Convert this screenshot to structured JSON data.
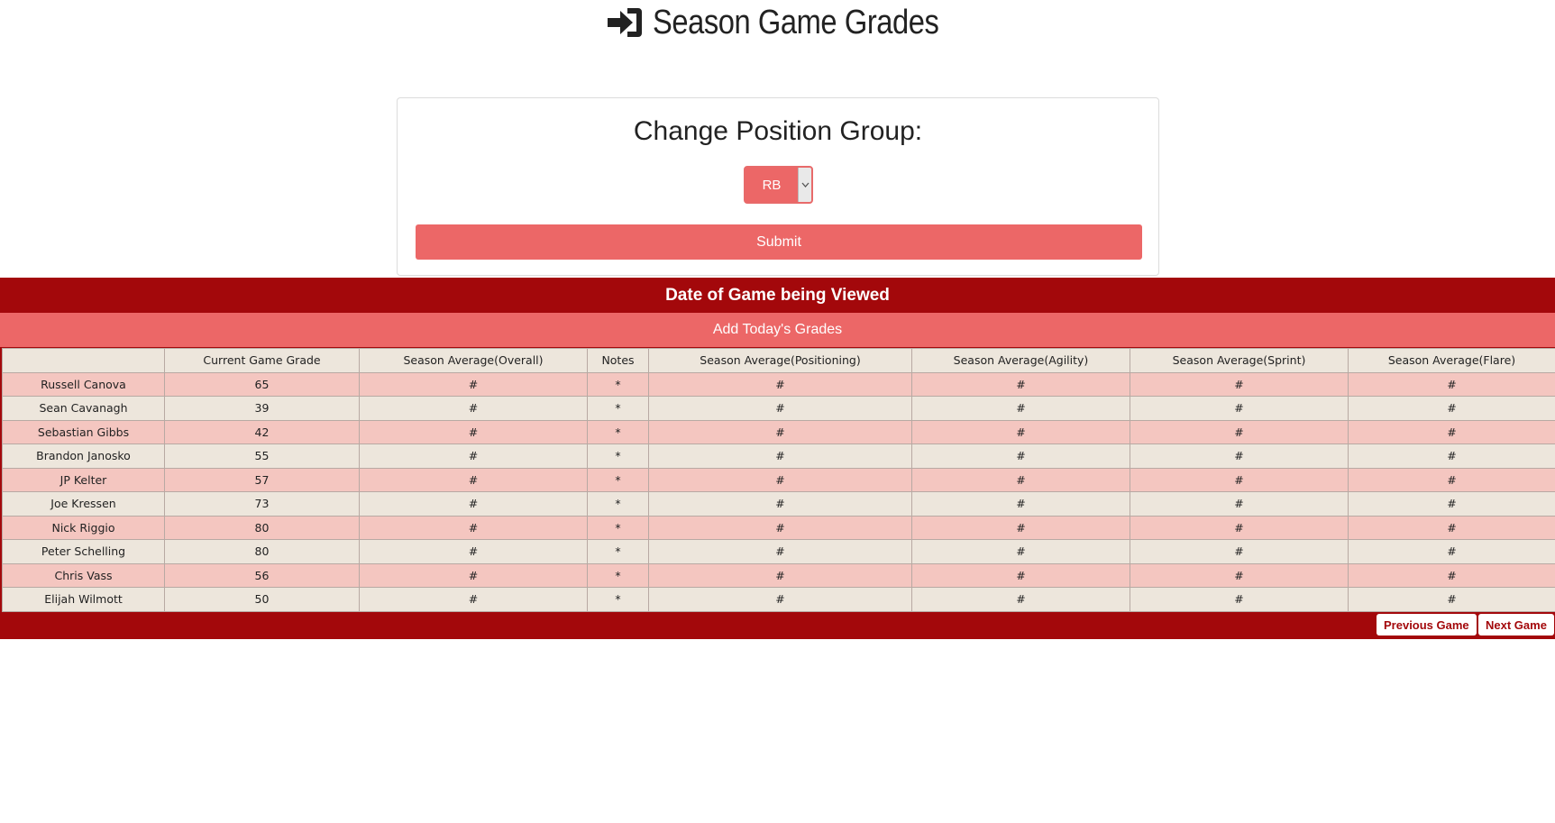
{
  "header": {
    "title": "Season Game Grades",
    "icon": "sign-in-icon"
  },
  "position_form": {
    "heading": "Change Position Group:",
    "selected_value": "RB",
    "submit_label": "Submit"
  },
  "date_banner": "Date of Game being Viewed",
  "add_grades_label": "Add Today's Grades",
  "table": {
    "columns": [
      "",
      "Current Game Grade",
      "Season Average(Overall)",
      "Notes",
      "Season Average(Positioning)",
      "Season Average(Agility)",
      "Season Average(Sprint)",
      "Season Average(Flare)"
    ],
    "rows": [
      [
        "Russell Canova",
        "65",
        "#",
        "*",
        "#",
        "#",
        "#",
        "#"
      ],
      [
        "Sean Cavanagh",
        "39",
        "#",
        "*",
        "#",
        "#",
        "#",
        "#"
      ],
      [
        "Sebastian Gibbs",
        "42",
        "#",
        "*",
        "#",
        "#",
        "#",
        "#"
      ],
      [
        "Brandon Janosko",
        "55",
        "#",
        "*",
        "#",
        "#",
        "#",
        "#"
      ],
      [
        "JP Kelter",
        "57",
        "#",
        "*",
        "#",
        "#",
        "#",
        "#"
      ],
      [
        "Joe Kressen",
        "73",
        "#",
        "*",
        "#",
        "#",
        "#",
        "#"
      ],
      [
        "Nick Riggio",
        "80",
        "#",
        "*",
        "#",
        "#",
        "#",
        "#"
      ],
      [
        "Peter Schelling",
        "80",
        "#",
        "*",
        "#",
        "#",
        "#",
        "#"
      ],
      [
        "Chris Vass",
        "56",
        "#",
        "*",
        "#",
        "#",
        "#",
        "#"
      ],
      [
        "Elijah Wilmott",
        "50",
        "#",
        "*",
        "#",
        "#",
        "#",
        "#"
      ]
    ]
  },
  "pagination": {
    "previous_label": "Previous Game",
    "next_label": "Next Game"
  },
  "colors": {
    "primary": "#a3080b",
    "accent": "#ec6767",
    "row_pink": "#f4c6c0",
    "row_beige": "#ede6dc"
  }
}
